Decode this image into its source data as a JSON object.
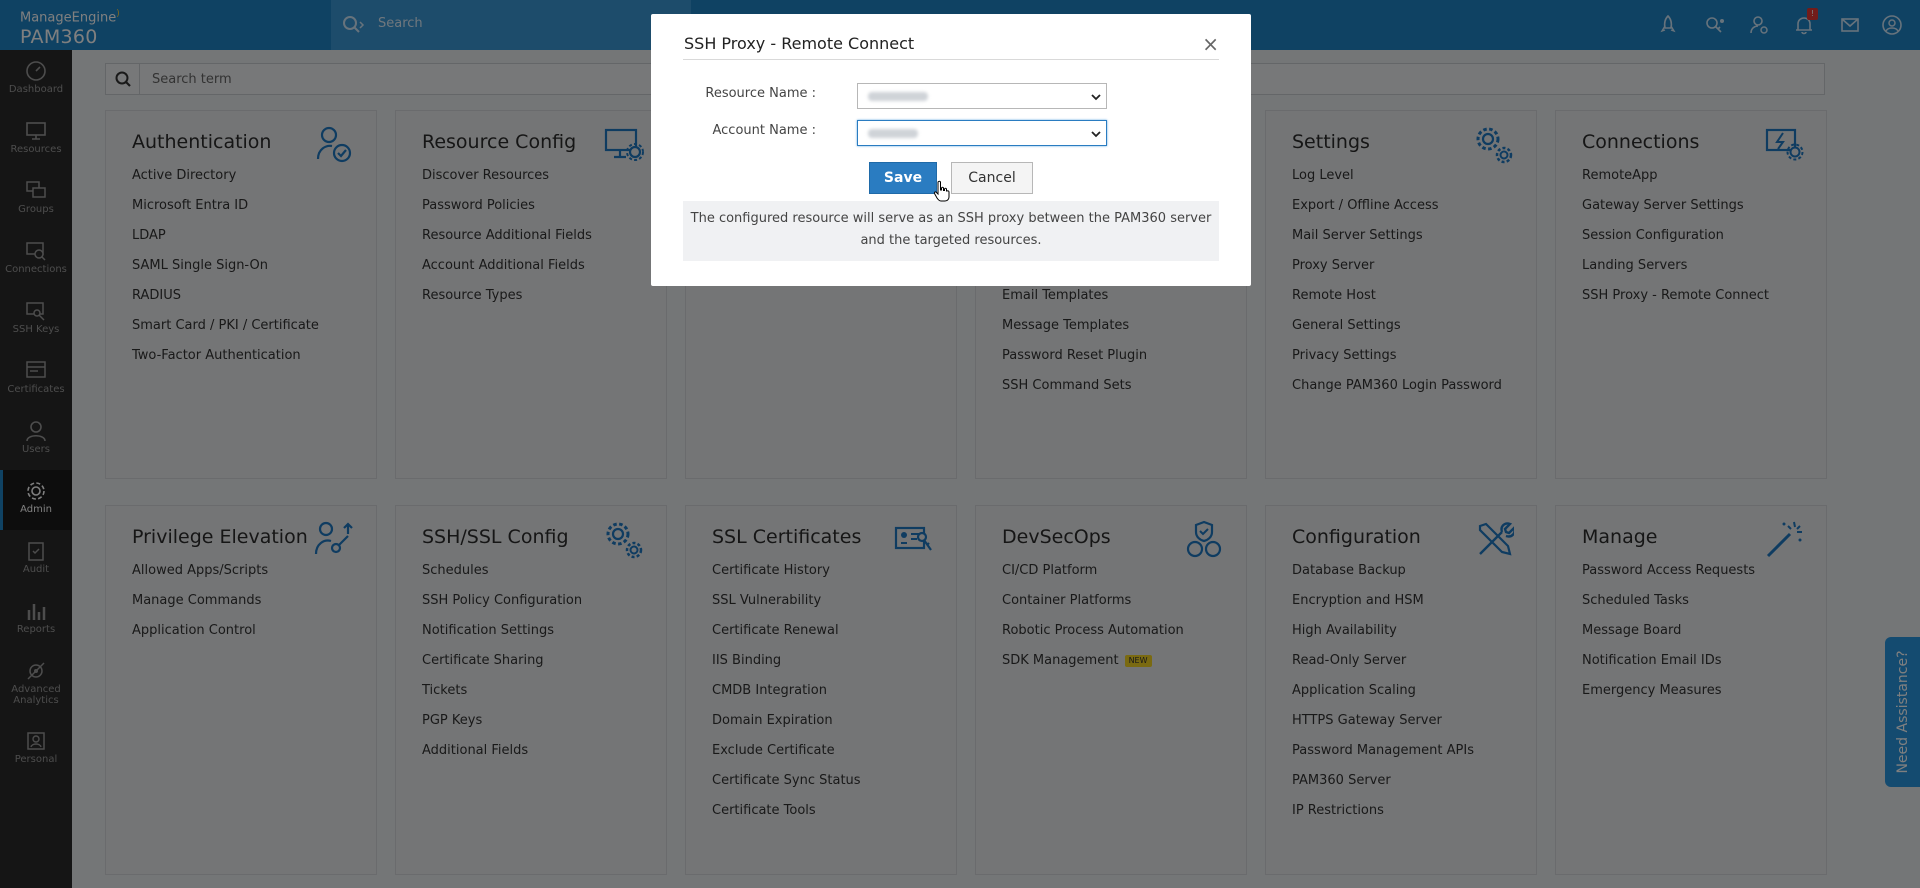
{
  "header": {
    "brand_top": "ManageEngine",
    "brand_product": "PAM360",
    "search_placeholder": "Search"
  },
  "sidebar": {
    "items": [
      {
        "label": "Dashboard",
        "icon": "dashboard-icon"
      },
      {
        "label": "Resources",
        "icon": "monitor-icon"
      },
      {
        "label": "Groups",
        "icon": "groups-icon"
      },
      {
        "label": "Connections",
        "icon": "connections-icon"
      },
      {
        "label": "SSH Keys",
        "icon": "key-icon"
      },
      {
        "label": "Certificates",
        "icon": "certificate-icon"
      },
      {
        "label": "Users",
        "icon": "user-icon"
      },
      {
        "label": "Admin",
        "icon": "gear-icon"
      },
      {
        "label": "Audit",
        "icon": "clipboard-icon"
      },
      {
        "label": "Reports",
        "icon": "bar-chart-icon"
      },
      {
        "label": "Advanced Analytics",
        "label_line1": "Advanced",
        "label_line2": "Analytics",
        "icon": "analytics-icon"
      },
      {
        "label": "Personal",
        "icon": "personal-icon"
      }
    ]
  },
  "search_term": {
    "placeholder": "Search term"
  },
  "cards_row1": [
    {
      "title": "Authentication",
      "items": [
        "Active Directory",
        "Microsoft Entra ID",
        "LDAP",
        "SAML Single Sign-On",
        "RADIUS",
        "Smart Card / PKI / Certificate",
        "Two-Factor Authentication"
      ]
    },
    {
      "title": "Resource Config",
      "items": [
        "Discover Resources",
        "Password Policies",
        "Resource Additional Fields",
        "Account Additional Fields",
        "Resource Types"
      ]
    },
    {
      "title": "",
      "items": []
    },
    {
      "title": "",
      "items": [
        "",
        "",
        "",
        "",
        "Email Templates",
        "Message Templates",
        "Password Reset Plugin",
        "SSH Command Sets"
      ]
    },
    {
      "title": "Settings",
      "items": [
        "Log Level",
        "Export / Offline Access",
        "Mail Server Settings",
        "Proxy Server",
        "Remote Host",
        "General Settings",
        "Privacy Settings",
        "Change PAM360 Login Password"
      ]
    },
    {
      "title": "Connections",
      "items": [
        "RemoteApp",
        "Gateway Server Settings",
        "Session Configuration",
        "Landing Servers",
        "SSH Proxy - Remote Connect"
      ]
    }
  ],
  "cards_row2": [
    {
      "title": "Privilege Elevation",
      "items": [
        "Allowed Apps/Scripts",
        "Manage Commands",
        "Application Control"
      ]
    },
    {
      "title": "SSH/SSL Config",
      "items": [
        "Schedules",
        "SSH Policy Configuration",
        "Notification Settings",
        "Certificate Sharing",
        "Tickets",
        "PGP Keys",
        "Additional Fields"
      ]
    },
    {
      "title": "SSL Certificates",
      "items": [
        "Certificate History",
        "SSL Vulnerability",
        "Certificate Renewal",
        "IIS Binding",
        "CMDB Integration",
        "Domain Expiration",
        "Exclude Certificate",
        "Certificate Sync Status",
        "Certificate Tools"
      ]
    },
    {
      "title": "DevSecOps",
      "items": [
        "CI/CD Platform",
        "Container Platforms",
        "Robotic Process Automation",
        "SDK Management"
      ],
      "new_tag": "NEW"
    },
    {
      "title": "Configuration",
      "items": [
        "Database Backup",
        "Encryption and HSM",
        "High Availability",
        "Read-Only Server",
        "Application Scaling",
        "HTTPS Gateway Server",
        "Password Management APIs",
        "PAM360 Server",
        "IP Restrictions"
      ]
    },
    {
      "title": "Manage",
      "items": [
        "Password Access Requests",
        "Scheduled Tasks",
        "Message Board",
        "Notification Email IDs",
        "Emergency Measures"
      ]
    }
  ],
  "modal": {
    "title": "SSH Proxy - Remote Connect",
    "close": "×",
    "resource_label": "Resource Name :",
    "account_label": "Account Name :",
    "save": "Save",
    "cancel": "Cancel",
    "note_line1": "The configured resource will serve as an SSH proxy between the PAM360 server",
    "note_line2": "and the targeted resources."
  },
  "assist": {
    "label": "Need Assistance?"
  },
  "colors": {
    "header": "#1e84c7",
    "sidebar": "#2b2b2b",
    "primary_button": "#2a7cc1",
    "icon_blue": "#1e78c2"
  }
}
